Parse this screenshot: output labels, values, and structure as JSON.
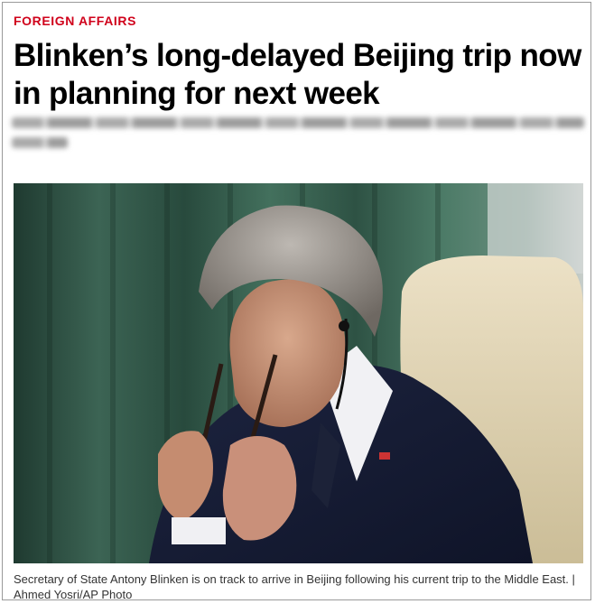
{
  "article": {
    "section": "FOREIGN AFFAIRS",
    "headline": "Blinken’s long-delayed Beijing trip now in planning for next week",
    "photo_alt": "Antony Blinken rubbing his eyes while holding his glasses",
    "caption": "Secretary of State Antony Blinken is on track to arrive in Beijing following his current trip to the Middle East. | Ahmed Yosri/AP Photo"
  },
  "colors": {
    "section": "#d0021b",
    "headline": "#000000",
    "caption": "#333333"
  }
}
